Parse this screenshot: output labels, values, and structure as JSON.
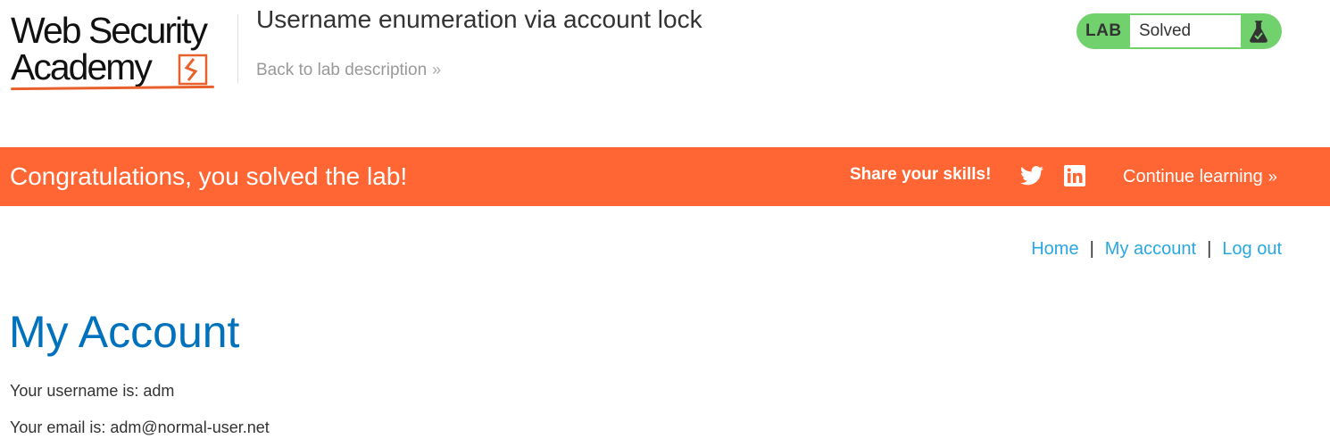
{
  "header": {
    "logo": {
      "line1": "Web Security",
      "line2": "Academy"
    },
    "lab_title": "Username enumeration via account lock",
    "back_link": "Back to lab description",
    "lab_badge": {
      "label": "LAB",
      "status": "Solved",
      "color": "#70d16d"
    }
  },
  "banner": {
    "message": "Congratulations, you solved the lab!",
    "share_label": "Share your skills!",
    "icons": [
      "twitter-icon",
      "linkedin-icon"
    ],
    "continue_label": "Continue learning",
    "color": "#ff6633"
  },
  "nav": {
    "home": "Home",
    "my_account": "My account",
    "log_out": "Log out",
    "separator": "|"
  },
  "content": {
    "title": "My Account",
    "username_line": "Your username is: adm",
    "email_line": "Your email is: adm@normal-user.net"
  },
  "colors": {
    "link": "#29a7e1",
    "heading": "#0071bc",
    "accent": "#ff6633"
  }
}
